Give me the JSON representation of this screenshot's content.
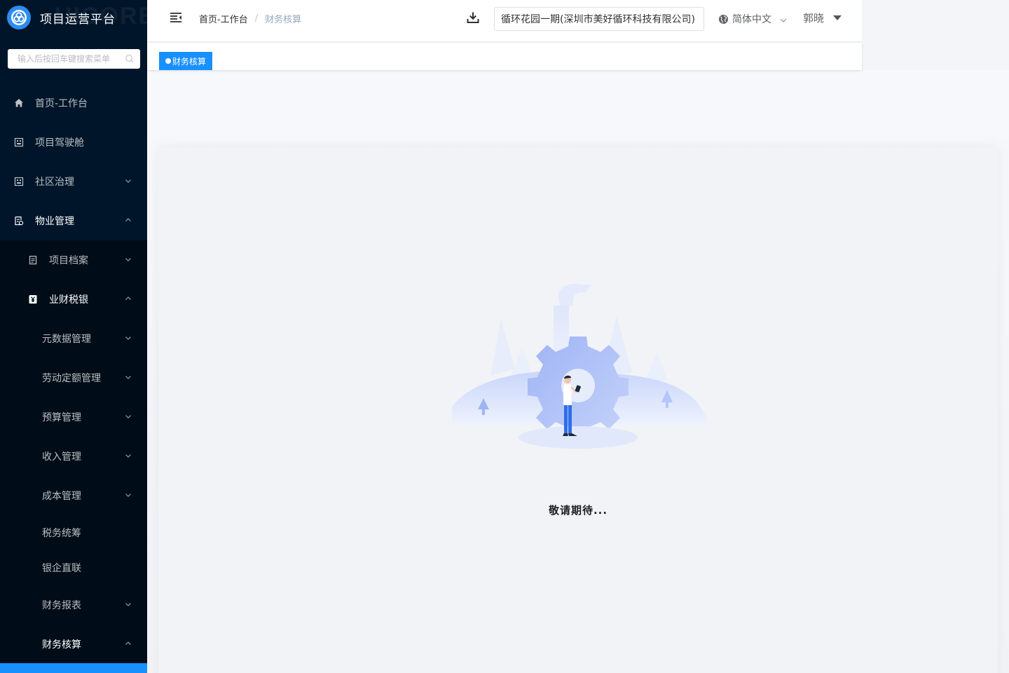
{
  "app": {
    "title": "项目运营平台",
    "logo_watermark": "UICORE"
  },
  "sidebar": {
    "search_placeholder": "输入后按回车键搜索菜单",
    "items": [
      {
        "label": "首页-工作台",
        "icon": "home-icon"
      },
      {
        "label": "项目驾驶舱",
        "icon": "grid-icon"
      },
      {
        "label": "社区治理",
        "icon": "grid-icon",
        "arrow": "down"
      },
      {
        "label": "物业管理",
        "icon": "document-icon",
        "arrow": "up"
      },
      {
        "label": "项目档案",
        "icon": "file-icon",
        "arrow": "down"
      },
      {
        "label": "业财税银",
        "icon": "yen-icon",
        "arrow": "up"
      },
      {
        "label": "元数据管理",
        "arrow": "down"
      },
      {
        "label": "劳动定额管理",
        "arrow": "down"
      },
      {
        "label": "预算管理",
        "arrow": "down"
      },
      {
        "label": "收入管理",
        "arrow": "down"
      },
      {
        "label": "成本管理",
        "arrow": "down"
      },
      {
        "label": "税务统筹"
      },
      {
        "label": "银企直联"
      },
      {
        "label": "财务报表",
        "arrow": "down"
      },
      {
        "label": "财务核算",
        "arrow": "up"
      }
    ]
  },
  "header": {
    "breadcrumb": [
      "首页-工作台",
      "财务核算"
    ],
    "breadcrumb_sep": "/",
    "project_select": "循环花园一期(深圳市美好循环科技有限公司)",
    "language": "简体中文",
    "user": "郭晓"
  },
  "tags": [
    {
      "label": "财务核算",
      "active": true
    }
  ],
  "content": {
    "message": "敬请期待..."
  },
  "colors": {
    "sidebar_bg": "#001529",
    "submenu_bg": "#000c17",
    "accent": "#1890ff",
    "logo": "#2d8cf0"
  }
}
